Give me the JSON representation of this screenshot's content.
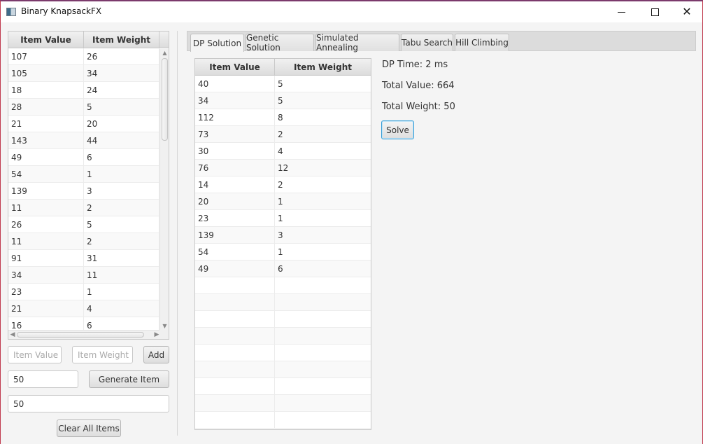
{
  "window": {
    "title": "Binary KnapsackFX",
    "controls": {
      "minimize": "minimize-icon",
      "maximize": "maximize-icon",
      "close": "close-icon"
    }
  },
  "items_table": {
    "columns": [
      "Item Value",
      "Item Weight"
    ],
    "rows": [
      [
        "107",
        "26"
      ],
      [
        "105",
        "34"
      ],
      [
        "18",
        "24"
      ],
      [
        "28",
        "5"
      ],
      [
        "21",
        "20"
      ],
      [
        "143",
        "44"
      ],
      [
        "49",
        "6"
      ],
      [
        "54",
        "1"
      ],
      [
        "139",
        "3"
      ],
      [
        "11",
        "2"
      ],
      [
        "26",
        "5"
      ],
      [
        "11",
        "2"
      ],
      [
        "91",
        "31"
      ],
      [
        "34",
        "11"
      ],
      [
        "23",
        "1"
      ],
      [
        "21",
        "4"
      ],
      [
        "16",
        "6"
      ]
    ]
  },
  "add_form": {
    "value_placeholder": "Item Value",
    "weight_placeholder": "Item Weight",
    "add_label": "Add",
    "generate_count": "50",
    "generate_label": "Generate Item",
    "capacity": "50",
    "clear_label": "Clear All Items"
  },
  "tabs": [
    {
      "label": "DP Solution",
      "active": true
    },
    {
      "label": "Genetic Solution",
      "active": false
    },
    {
      "label": "Simulated Annealing",
      "active": false
    },
    {
      "label": "Tabu Search",
      "active": false
    },
    {
      "label": "Hill Climbing",
      "active": false
    }
  ],
  "dp_solution": {
    "columns": [
      "Item Value",
      "Item Weight"
    ],
    "rows": [
      [
        "40",
        "5"
      ],
      [
        "34",
        "5"
      ],
      [
        "112",
        "8"
      ],
      [
        "73",
        "2"
      ],
      [
        "30",
        "4"
      ],
      [
        "76",
        "12"
      ],
      [
        "14",
        "2"
      ],
      [
        "20",
        "1"
      ],
      [
        "23",
        "1"
      ],
      [
        "139",
        "3"
      ],
      [
        "54",
        "1"
      ],
      [
        "49",
        "6"
      ]
    ],
    "empty_rows": 9,
    "time_label": "DP Time: 2 ms",
    "total_value_label": "Total Value: 664",
    "total_weight_label": "Total Weight: 50",
    "solve_label": "Solve"
  }
}
